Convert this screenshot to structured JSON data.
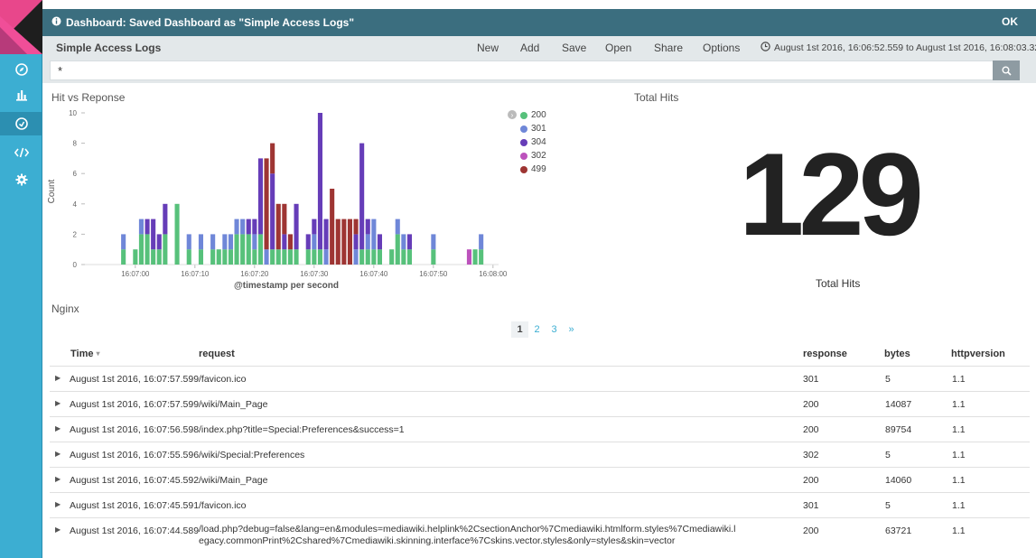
{
  "topbar": {
    "message": "Dashboard: Saved Dashboard as \"Simple Access Logs\"",
    "ok_label": "OK"
  },
  "titlebar": {
    "title": "Simple Access Logs",
    "menu": [
      "New",
      "Add",
      "Save",
      "Open",
      "Share",
      "Options"
    ],
    "time_range": "August 1st 2016, 16:06:52.559 to August 1st 2016, 16:08:03.328"
  },
  "search": {
    "value": "*"
  },
  "sidebar": {
    "icons": [
      "compass-icon",
      "bar-chart-icon",
      "dashboard-icon",
      "code-icon",
      "gear-icon"
    ]
  },
  "panels": {
    "chart_title": "Hit vs Reponse",
    "metric_title": "Total Hits",
    "metric_value": "129",
    "metric_label": "Total Hits",
    "table_title": "Nginx"
  },
  "colors": {
    "200": "#57c17b",
    "301": "#6f87d8",
    "304": "#663db8",
    "302": "#bc52bc",
    "499": "#9e3533"
  },
  "chart_data": {
    "type": "bar",
    "stacked": true,
    "ylabel": "Count",
    "xlabel": "@timestamp per second",
    "yticks": [
      "0",
      "2",
      "4",
      "6",
      "8",
      "10"
    ],
    "ylim": [
      0,
      10
    ],
    "xticks": [
      "16:07:00",
      "16:07:10",
      "16:07:20",
      "16:07:30",
      "16:07:40",
      "16:07:50",
      "16:08:00"
    ],
    "x_start": 52,
    "legend": [
      "200",
      "301",
      "304",
      "302",
      "499"
    ],
    "bars": [
      {
        "x": 58,
        "stack": [
          [
            "200",
            1
          ],
          [
            "301",
            1
          ]
        ]
      },
      {
        "x": 60,
        "stack": [
          [
            "200",
            1
          ]
        ]
      },
      {
        "x": 61,
        "stack": [
          [
            "200",
            2
          ],
          [
            "301",
            1
          ]
        ]
      },
      {
        "x": 62,
        "stack": [
          [
            "200",
            2
          ],
          [
            "304",
            1
          ]
        ]
      },
      {
        "x": 63,
        "stack": [
          [
            "200",
            1
          ],
          [
            "304",
            2
          ]
        ]
      },
      {
        "x": 64,
        "stack": [
          [
            "200",
            1
          ],
          [
            "304",
            1
          ]
        ]
      },
      {
        "x": 65,
        "stack": [
          [
            "200",
            2
          ],
          [
            "304",
            2
          ]
        ]
      },
      {
        "x": 67,
        "stack": [
          [
            "200",
            4
          ]
        ]
      },
      {
        "x": 69,
        "stack": [
          [
            "200",
            1
          ],
          [
            "301",
            1
          ]
        ]
      },
      {
        "x": 71,
        "stack": [
          [
            "200",
            1
          ],
          [
            "301",
            1
          ]
        ]
      },
      {
        "x": 73,
        "stack": [
          [
            "200",
            1
          ],
          [
            "301",
            1
          ]
        ]
      },
      {
        "x": 74,
        "stack": [
          [
            "200",
            1
          ]
        ]
      },
      {
        "x": 75,
        "stack": [
          [
            "200",
            1
          ],
          [
            "301",
            1
          ]
        ]
      },
      {
        "x": 76,
        "stack": [
          [
            "200",
            1
          ],
          [
            "301",
            1
          ]
        ]
      },
      {
        "x": 77,
        "stack": [
          [
            "200",
            2
          ],
          [
            "301",
            1
          ]
        ]
      },
      {
        "x": 78,
        "stack": [
          [
            "200",
            2
          ],
          [
            "301",
            1
          ]
        ]
      },
      {
        "x": 79,
        "stack": [
          [
            "200",
            2
          ],
          [
            "304",
            1
          ]
        ]
      },
      {
        "x": 80,
        "stack": [
          [
            "200",
            1
          ],
          [
            "301",
            1
          ],
          [
            "304",
            1
          ]
        ]
      },
      {
        "x": 81,
        "stack": [
          [
            "200",
            2
          ],
          [
            "304",
            5
          ]
        ]
      },
      {
        "x": 82,
        "stack": [
          [
            "301",
            1
          ],
          [
            "499",
            6
          ]
        ]
      },
      {
        "x": 83,
        "stack": [
          [
            "200",
            1
          ],
          [
            "304",
            5
          ],
          [
            "499",
            2
          ]
        ]
      },
      {
        "x": 84,
        "stack": [
          [
            "200",
            1
          ],
          [
            "499",
            3
          ]
        ]
      },
      {
        "x": 85,
        "stack": [
          [
            "200",
            1
          ],
          [
            "304",
            1
          ],
          [
            "499",
            2
          ]
        ]
      },
      {
        "x": 86,
        "stack": [
          [
            "200",
            1
          ],
          [
            "499",
            1
          ]
        ]
      },
      {
        "x": 87,
        "stack": [
          [
            "200",
            1
          ],
          [
            "304",
            3
          ]
        ]
      },
      {
        "x": 89,
        "stack": [
          [
            "200",
            1
          ],
          [
            "304",
            1
          ]
        ]
      },
      {
        "x": 90,
        "stack": [
          [
            "200",
            1
          ],
          [
            "301",
            1
          ],
          [
            "304",
            1
          ]
        ]
      },
      {
        "x": 91,
        "stack": [
          [
            "200",
            1
          ],
          [
            "304",
            9
          ]
        ]
      },
      {
        "x": 92,
        "stack": [
          [
            "301",
            1
          ],
          [
            "304",
            2
          ]
        ]
      },
      {
        "x": 93,
        "stack": [
          [
            "499",
            5
          ]
        ]
      },
      {
        "x": 94,
        "stack": [
          [
            "499",
            3
          ]
        ]
      },
      {
        "x": 95,
        "stack": [
          [
            "499",
            3
          ]
        ]
      },
      {
        "x": 96,
        "stack": [
          [
            "499",
            3
          ]
        ]
      },
      {
        "x": 97,
        "stack": [
          [
            "301",
            1
          ],
          [
            "304",
            1
          ],
          [
            "499",
            1
          ]
        ]
      },
      {
        "x": 98,
        "stack": [
          [
            "200",
            1
          ],
          [
            "304",
            7
          ]
        ]
      },
      {
        "x": 99,
        "stack": [
          [
            "200",
            1
          ],
          [
            "301",
            1
          ],
          [
            "304",
            1
          ]
        ]
      },
      {
        "x": 100,
        "stack": [
          [
            "200",
            1
          ],
          [
            "301",
            2
          ]
        ]
      },
      {
        "x": 101,
        "stack": [
          [
            "200",
            1
          ],
          [
            "304",
            1
          ]
        ]
      },
      {
        "x": 103,
        "stack": [
          [
            "200",
            1
          ]
        ]
      },
      {
        "x": 104,
        "stack": [
          [
            "200",
            2
          ],
          [
            "301",
            1
          ]
        ]
      },
      {
        "x": 105,
        "stack": [
          [
            "200",
            1
          ],
          [
            "301",
            1
          ]
        ]
      },
      {
        "x": 106,
        "stack": [
          [
            "200",
            1
          ],
          [
            "304",
            1
          ]
        ]
      },
      {
        "x": 110,
        "stack": [
          [
            "200",
            1
          ],
          [
            "301",
            1
          ]
        ]
      },
      {
        "x": 116,
        "stack": [
          [
            "302",
            1
          ]
        ]
      },
      {
        "x": 117,
        "stack": [
          [
            "200",
            1
          ]
        ]
      },
      {
        "x": 118,
        "stack": [
          [
            "200",
            1
          ],
          [
            "301",
            1
          ]
        ]
      }
    ]
  },
  "table": {
    "headers": {
      "time": "Time",
      "request": "request",
      "response": "response",
      "bytes": "bytes",
      "httpversion": "httpversion"
    },
    "rows": [
      {
        "time": "August 1st 2016, 16:07:57.599",
        "request": "/favicon.ico",
        "response": "301",
        "bytes": "5",
        "httpversion": "1.1"
      },
      {
        "time": "August 1st 2016, 16:07:57.599",
        "request": "/wiki/Main_Page",
        "response": "200",
        "bytes": "14087",
        "httpversion": "1.1"
      },
      {
        "time": "August 1st 2016, 16:07:56.598",
        "request": "/index.php?title=Special:Preferences&success=1",
        "response": "200",
        "bytes": "89754",
        "httpversion": "1.1"
      },
      {
        "time": "August 1st 2016, 16:07:55.596",
        "request": "/wiki/Special:Preferences",
        "response": "302",
        "bytes": "5",
        "httpversion": "1.1"
      },
      {
        "time": "August 1st 2016, 16:07:45.592",
        "request": "/wiki/Main_Page",
        "response": "200",
        "bytes": "14060",
        "httpversion": "1.1"
      },
      {
        "time": "August 1st 2016, 16:07:45.591",
        "request": "/favicon.ico",
        "response": "301",
        "bytes": "5",
        "httpversion": "1.1"
      },
      {
        "time": "August 1st 2016, 16:07:44.589",
        "request": "/load.php?debug=false&lang=en&modules=mediawiki.helplink%2CsectionAnchor%7Cmediawiki.htmlform.styles%7Cmediawiki.l",
        "request_line2": "egacy.commonPrint%2Cshared%7Cmediawiki.skinning.interface%7Cskins.vector.styles&only=styles&skin=vector",
        "response": "200",
        "bytes": "63721",
        "httpversion": "1.1"
      }
    ]
  },
  "pager": {
    "pages": [
      "1",
      "2",
      "3",
      "»"
    ],
    "current": "1"
  }
}
